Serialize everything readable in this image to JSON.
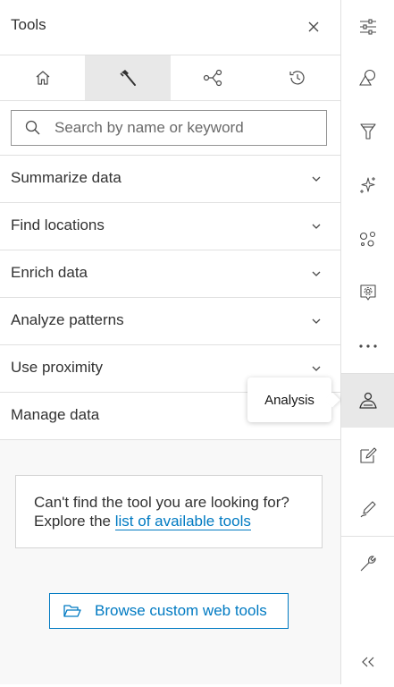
{
  "panel": {
    "title": "Tools",
    "close_icon": "close-icon"
  },
  "tabs": [
    {
      "icon": "home-icon",
      "active": false
    },
    {
      "icon": "hammer-icon",
      "active": true
    },
    {
      "icon": "workflow-icon",
      "active": false
    },
    {
      "icon": "history-icon",
      "active": false
    }
  ],
  "search": {
    "placeholder": "Search by name or keyword",
    "value": "",
    "icon": "search-icon"
  },
  "sections": [
    {
      "label": "Summarize data",
      "icon": "chevron-down-icon"
    },
    {
      "label": "Find locations",
      "icon": "chevron-down-icon"
    },
    {
      "label": "Enrich data",
      "icon": "chevron-down-icon"
    },
    {
      "label": "Analyze patterns",
      "icon": "chevron-down-icon"
    },
    {
      "label": "Use proximity",
      "icon": "chevron-down-icon"
    },
    {
      "label": "Manage data",
      "icon": "chevron-down-icon"
    }
  ],
  "notice": {
    "text": "Can't find the tool you are looking for? Explore the ",
    "link": "list of available tools"
  },
  "browse_button": {
    "label": "Browse custom web tools",
    "icon": "folder-open-icon"
  },
  "tooltip": {
    "text": "Analysis"
  },
  "actionbar": {
    "items": [
      {
        "icon": "sliders-icon",
        "active": false
      },
      {
        "icon": "shapes-icon",
        "active": false
      },
      {
        "icon": "filter-icon",
        "active": false
      },
      {
        "icon": "sparkles-icon",
        "active": false
      },
      {
        "icon": "nodes-icon",
        "active": false
      },
      {
        "icon": "config-popup-icon",
        "active": false
      },
      {
        "icon": "more-icon",
        "active": false
      },
      {
        "icon": "analysis-icon",
        "active": true
      },
      {
        "icon": "edit-icon",
        "active": false
      },
      {
        "icon": "sketch-icon",
        "active": false
      },
      {
        "icon": "wrench-icon",
        "active": false
      },
      {
        "icon": "collapse-icon",
        "active": false
      }
    ]
  },
  "colors": {
    "accent": "#007ac2",
    "text": "#323232",
    "active_bg": "#e8e8e8",
    "border": "#e0e0e0"
  }
}
